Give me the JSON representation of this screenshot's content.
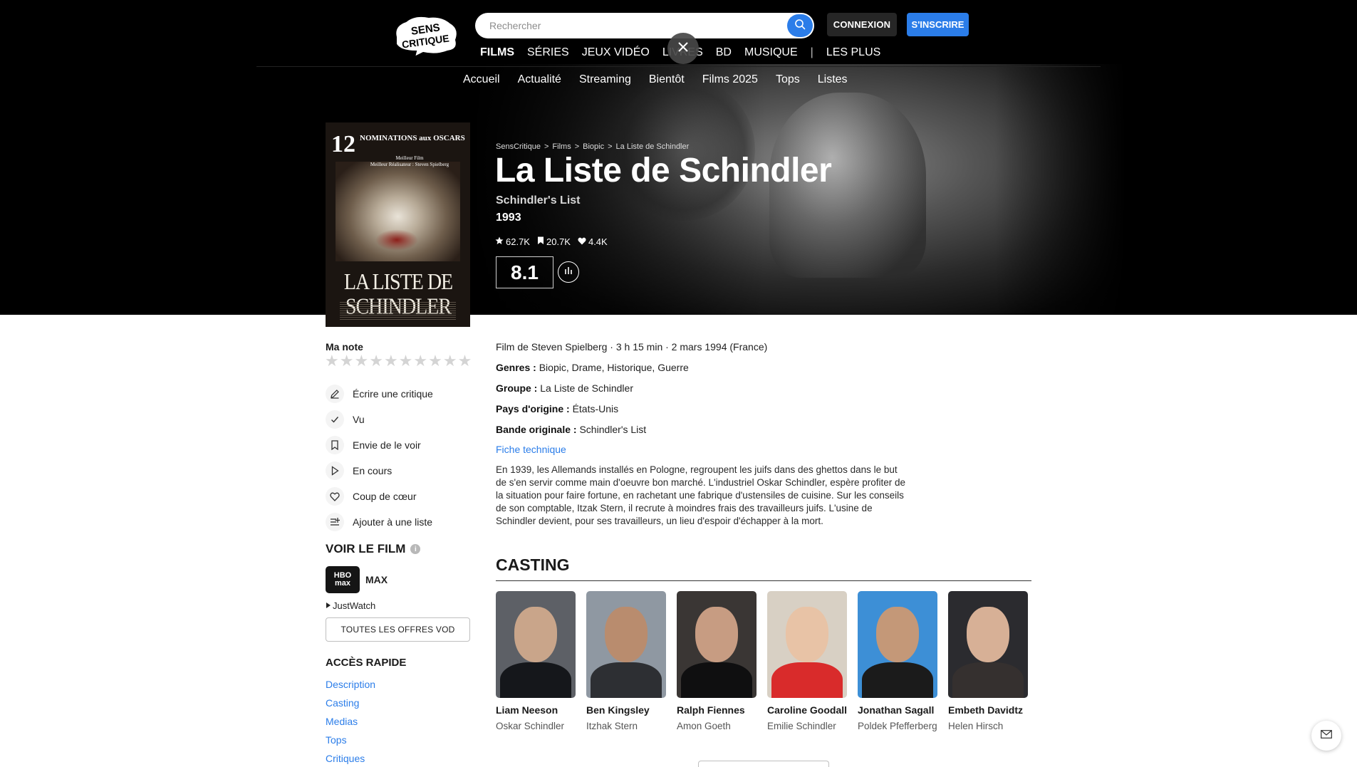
{
  "header": {
    "logo_text": "SENS CRITIQUE",
    "search_placeholder": "Rechercher",
    "connexion_label": "CONNEXION",
    "inscrire_label": "S'INSCRIRE",
    "main_nav": [
      "FILMS",
      "SÉRIES",
      "JEUX VIDÉO",
      "LIVRES",
      "BD",
      "MUSIQUE"
    ],
    "main_nav_extra": "LES PLUS",
    "sub_nav": [
      "Accueil",
      "Actualité",
      "Streaming",
      "Bientôt",
      "Films 2025",
      "Tops",
      "Listes"
    ]
  },
  "poster": {
    "top_number": "12",
    "top_line": "NOMINATIONS aux OSCARS",
    "line2": "Meilleur Film",
    "line3": "Meilleur Réalisateur : Steven Spielberg",
    "title": "LA LISTE DE SCHINDLER"
  },
  "movie": {
    "breadcrumb": [
      "SensCritique",
      "Films",
      "Biopic",
      "La Liste de Schindler"
    ],
    "title": "La Liste de Schindler",
    "original_title": "Schindler's List",
    "year": "1993",
    "stats": {
      "ratings": "62.7K",
      "wishlist": "20.7K",
      "favorites": "4.4K"
    },
    "score": "8.1",
    "meta_line": "Film de Steven Spielberg · 3 h 15 min · 2 mars 1994 (France)",
    "genres_label": "Genres :",
    "genres": "Biopic, Drame, Historique, Guerre",
    "groupe_label": "Groupe :",
    "groupe": "La Liste de Schindler",
    "pays_label": "Pays d'origine :",
    "pays": "États-Unis",
    "bande_label": "Bande originale :",
    "bande": "Schindler's List",
    "fiche_label": "Fiche technique",
    "synopsis": "En 1939, les Allemands installés en Pologne, regroupent les juifs dans des ghettos dans le but de s'en servir comme main d'oeuvre bon marché. L'industriel Oskar Schindler, espère profiter de la situation pour faire fortune, en rachetant une fabrique d'ustensiles de cuisine. Sur les conseils de son comptable, Itzak Stern, il recrute à moindres frais des travailleurs juifs. L'usine de Schindler devient, pour ses travailleurs, un lieu d'espoir d'échapper à la mort."
  },
  "sidebar": {
    "ma_note_label": "Ma note",
    "star_count": 10,
    "actions": [
      {
        "label": "Écrire une critique",
        "icon": "pencil-icon"
      },
      {
        "label": "Vu",
        "icon": "check-icon"
      },
      {
        "label": "Envie de le voir",
        "icon": "bookmark-icon"
      },
      {
        "label": "En cours",
        "icon": "play-icon"
      },
      {
        "label": "Coup de cœur",
        "icon": "heart-icon"
      },
      {
        "label": "Ajouter à une liste",
        "icon": "list-add-icon"
      }
    ],
    "voir_title": "VOIR LE FILM",
    "provider_logo_top": "HBO",
    "provider_logo_bottom": "max",
    "provider_name": "MAX",
    "justwatch": "JustWatch",
    "vod_button": "TOUTES LES OFFRES VOD",
    "acces_title": "ACCÈS RAPIDE",
    "acces_links": [
      "Description",
      "Casting",
      "Medias",
      "Tops",
      "Critiques"
    ]
  },
  "casting": {
    "title": "CASTING",
    "actors": [
      {
        "name": "Liam Neeson",
        "role": "Oskar Schindler",
        "bg": "#5d6066",
        "skin": "#c9a58a",
        "suit": "#15171b"
      },
      {
        "name": "Ben Kingsley",
        "role": "Itzhak Stern",
        "bg": "#8f98a2",
        "skin": "#b98c6e",
        "suit": "#2d2f33"
      },
      {
        "name": "Ralph Fiennes",
        "role": "Amon Goeth",
        "bg": "#3a3634",
        "skin": "#c79c82",
        "suit": "#0f0f10"
      },
      {
        "name": "Caroline Goodall",
        "role": "Emilie Schindler",
        "bg": "#d8d0c4",
        "skin": "#e8c3a6",
        "suit": "#d92b2b"
      },
      {
        "name": "Jonathan Sagall",
        "role": "Poldek Pfefferberg",
        "bg": "#3d8fd6",
        "skin": "#c49878",
        "suit": "#1b1b1b"
      },
      {
        "name": "Embeth Davidtz",
        "role": "Helen Hirsch",
        "bg": "#2b2b2f",
        "skin": "#d7b096",
        "suit": "#35302f"
      }
    ]
  }
}
